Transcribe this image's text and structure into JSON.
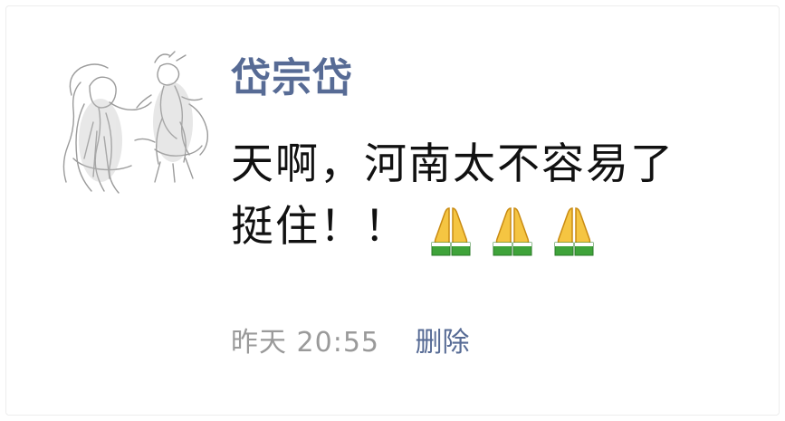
{
  "post": {
    "username": "岱宗岱",
    "message_line1": "天啊，河南太不容易了",
    "message_line2": "挺住！！",
    "emoji": [
      "pray-hands-emoji",
      "pray-hands-emoji",
      "pray-hands-emoji"
    ],
    "timestamp": "昨天 20:55",
    "delete_label": "删除"
  },
  "colors": {
    "link": "#576b95",
    "timestamp": "#9a9a9a",
    "text": "#111111"
  }
}
